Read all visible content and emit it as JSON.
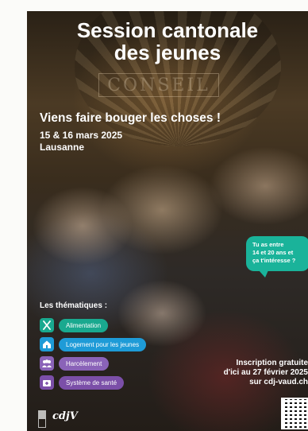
{
  "poster": {
    "title_line1": "Session cantonale",
    "title_line2": "des jeunes",
    "sign_text": "CONSEIL",
    "tagline": "Viens faire bouger les choses !",
    "date": "15 & 16 mars 2025",
    "place": "Lausanne",
    "bubble": {
      "line1": "Tu as entre",
      "line2": "14 et 20 ans et",
      "line3": "ça t'intéresse ?",
      "color": "#1ab39a"
    },
    "themes_heading": "Les thématiques :",
    "themes": [
      {
        "label": "Alimentation",
        "icon": "cutlery-icon",
        "color": "#19a98f"
      },
      {
        "label": "Logement pour les jeunes",
        "icon": "house-icon",
        "color": "#1e9bd7"
      },
      {
        "label": "Harcèlement",
        "icon": "people-icon",
        "color": "#8a63b8"
      },
      {
        "label": "Système de santé",
        "icon": "medical-kit-icon",
        "color": "#7b4fa8"
      }
    ],
    "inscription": {
      "line1": "Inscription gratuite",
      "line2": "d'ici au 27 février 2025",
      "line3": "sur cdj-vaud.ch"
    },
    "logo_text": "cdjV"
  }
}
